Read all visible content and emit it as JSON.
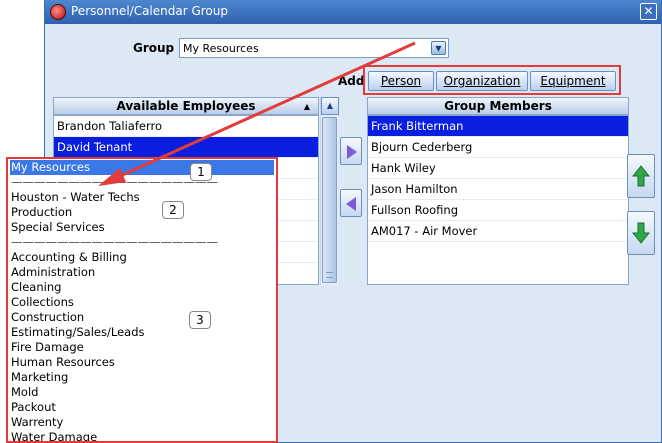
{
  "window": {
    "title": "Personnel/Calendar Group",
    "close_glyph": "✕"
  },
  "group": {
    "label": "Group",
    "value": "My Resources"
  },
  "add": {
    "label": "Add",
    "buttons": [
      "Person",
      "Organization",
      "Equipment"
    ]
  },
  "available": {
    "header": "Available Employees",
    "items": [
      "Brandon Taliaferro",
      "David Tenant",
      "",
      "",
      "",
      "",
      ""
    ],
    "selected_index": 1
  },
  "members": {
    "header": "Group Members",
    "items": [
      "Frank Bitterman",
      "Bjourn Cederberg",
      "Hank Wiley",
      "Jason Hamilton",
      "Fullson Roofing",
      "AM017 - Air Mover"
    ],
    "selected_index": 0
  },
  "dropdown": {
    "items": [
      "My Resources",
      "——————————————————",
      "Houston - Water Techs",
      "Production",
      "Special Services",
      "——————————————————",
      "Accounting & Billing",
      "Administration",
      "Cleaning",
      "Collections",
      "Construction",
      "Estimating/Sales/Leads",
      "Fire Damage",
      "Human Resources",
      "Marketing",
      "Mold",
      "Packout",
      "Warrenty",
      "Water Damage"
    ],
    "selected_index": 0
  },
  "callouts": [
    "1",
    "2",
    "3"
  ],
  "colors": {
    "highlight": "#e23b3b",
    "selection": "#0a1ee0",
    "titlebar": "#2e62b0"
  },
  "icons": {
    "move_right": "right-arrow-icon",
    "move_left": "left-arrow-icon",
    "move_up": "green-up-arrow-icon",
    "move_down": "green-down-arrow-icon"
  }
}
